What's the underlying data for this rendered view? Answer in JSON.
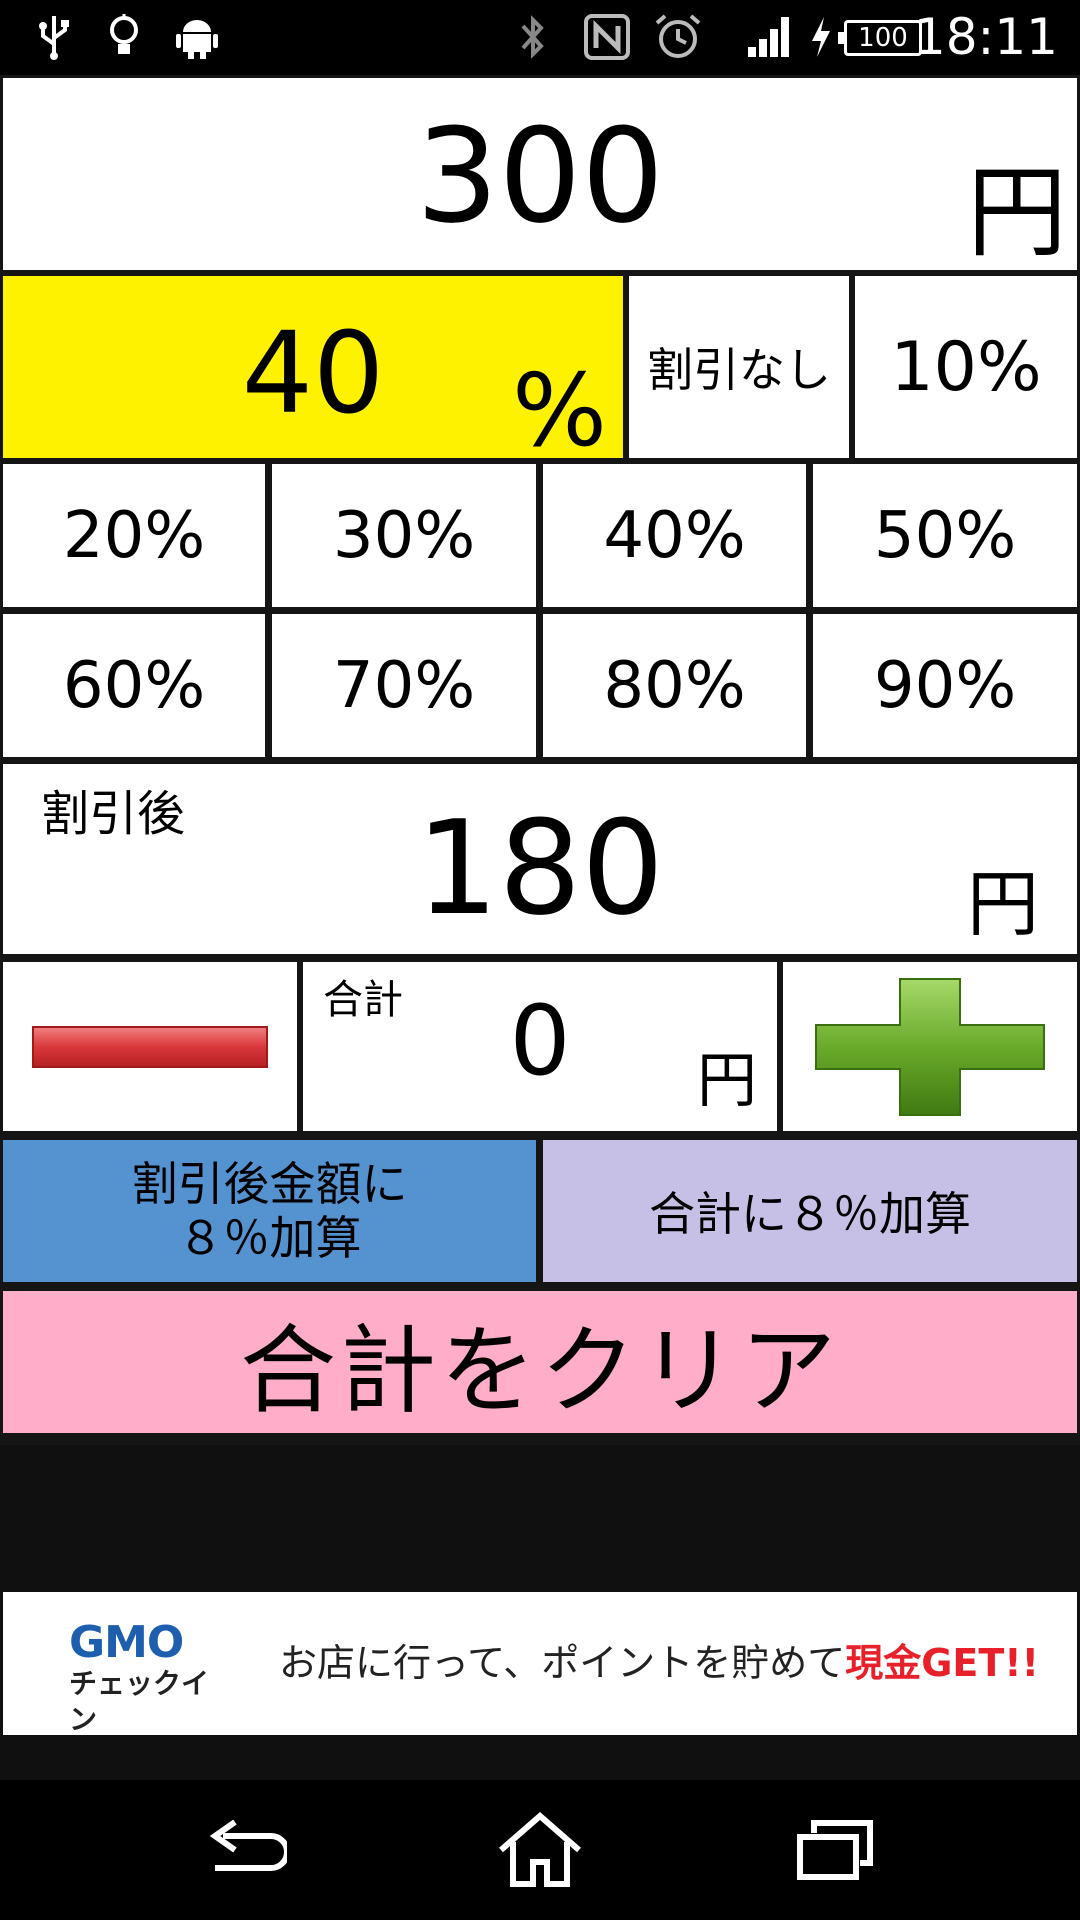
{
  "status_bar": {
    "time": "18:11",
    "battery": "100",
    "icons": [
      "usb-icon",
      "lightbulb-icon",
      "android-icon",
      "bluetooth-icon",
      "nfc-icon",
      "alarm-icon",
      "signal-icon",
      "charging-icon"
    ]
  },
  "price": {
    "value": "300",
    "unit": "円"
  },
  "discount": {
    "value": "40",
    "unit": "%",
    "highlight_color": "#fff200",
    "no_discount_label": "割引なし",
    "presets": [
      "10%",
      "20%",
      "30%",
      "40%",
      "50%",
      "60%",
      "70%",
      "80%",
      "90%"
    ]
  },
  "after_discount": {
    "label": "割引後",
    "value": "180",
    "unit": "円"
  },
  "total": {
    "label": "合計",
    "value": "0",
    "unit": "円",
    "minus_color": "#d9383b",
    "plus_color": "#6aaa2a"
  },
  "tax_buttons": {
    "after_discount_tax": "割引後金額に\n８％加算",
    "total_tax": "合計に８％加算",
    "after_discount_color": "#5592d0",
    "total_color": "#c6c0e6"
  },
  "clear_button": {
    "label": "合計をクリア",
    "color": "#ffadc9"
  },
  "ad": {
    "logo_top": "GMO",
    "logo_bottom": "チェックイン",
    "text": "お店に行って、ポイントを貯めて",
    "highlight": "現金GET!!",
    "highlight_color": "#e8202a"
  },
  "nav_bar": {
    "buttons": [
      "back-icon",
      "home-icon",
      "recent-apps-icon"
    ]
  }
}
